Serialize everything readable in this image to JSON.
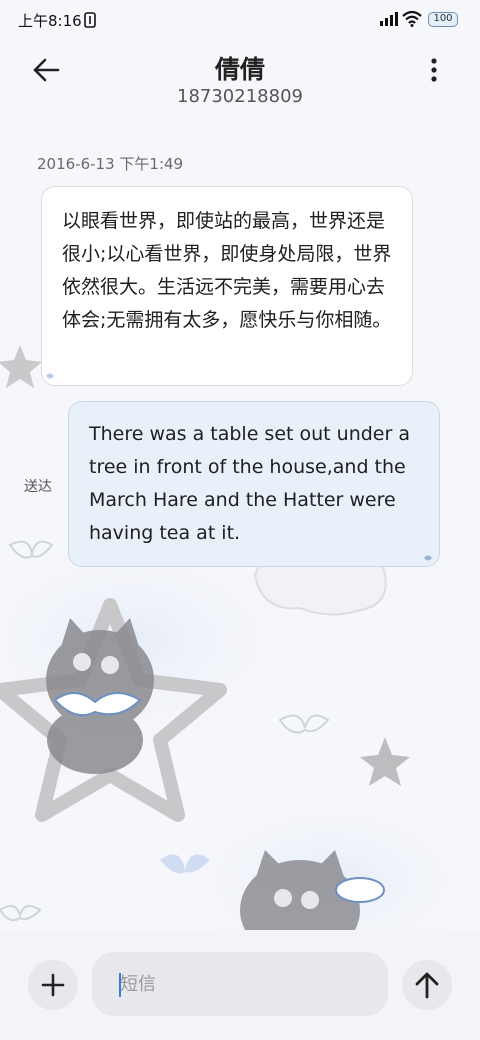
{
  "status_bar": {
    "time": "上午8:16",
    "battery": "100"
  },
  "header": {
    "contact_name": "倩倩",
    "phone_number": "18730218809"
  },
  "conversation": {
    "timestamp": "2016-6-13 下午1:49",
    "incoming_message": "以眼看世界，即使站的最高，世界还是很小;以心看世界，即使身处局限，世界依然很大。生活远不完美，需要用心去体会;无需拥有太多，愿快乐与你相随。",
    "outgoing_message": "There was a table set out under a tree in front of the house,and the March Hare and the Hatter were having tea at it.",
    "outgoing_status": "送达"
  },
  "composer": {
    "placeholder": "短信"
  },
  "icons": {
    "back": "arrow-left-icon",
    "more": "more-vertical-icon",
    "add": "plus-icon",
    "send": "arrow-up-icon"
  },
  "colors": {
    "outgoing_bubble": "#e8f0fa",
    "incoming_bubble": "#ffffff",
    "caret": "#3d7bd9"
  }
}
